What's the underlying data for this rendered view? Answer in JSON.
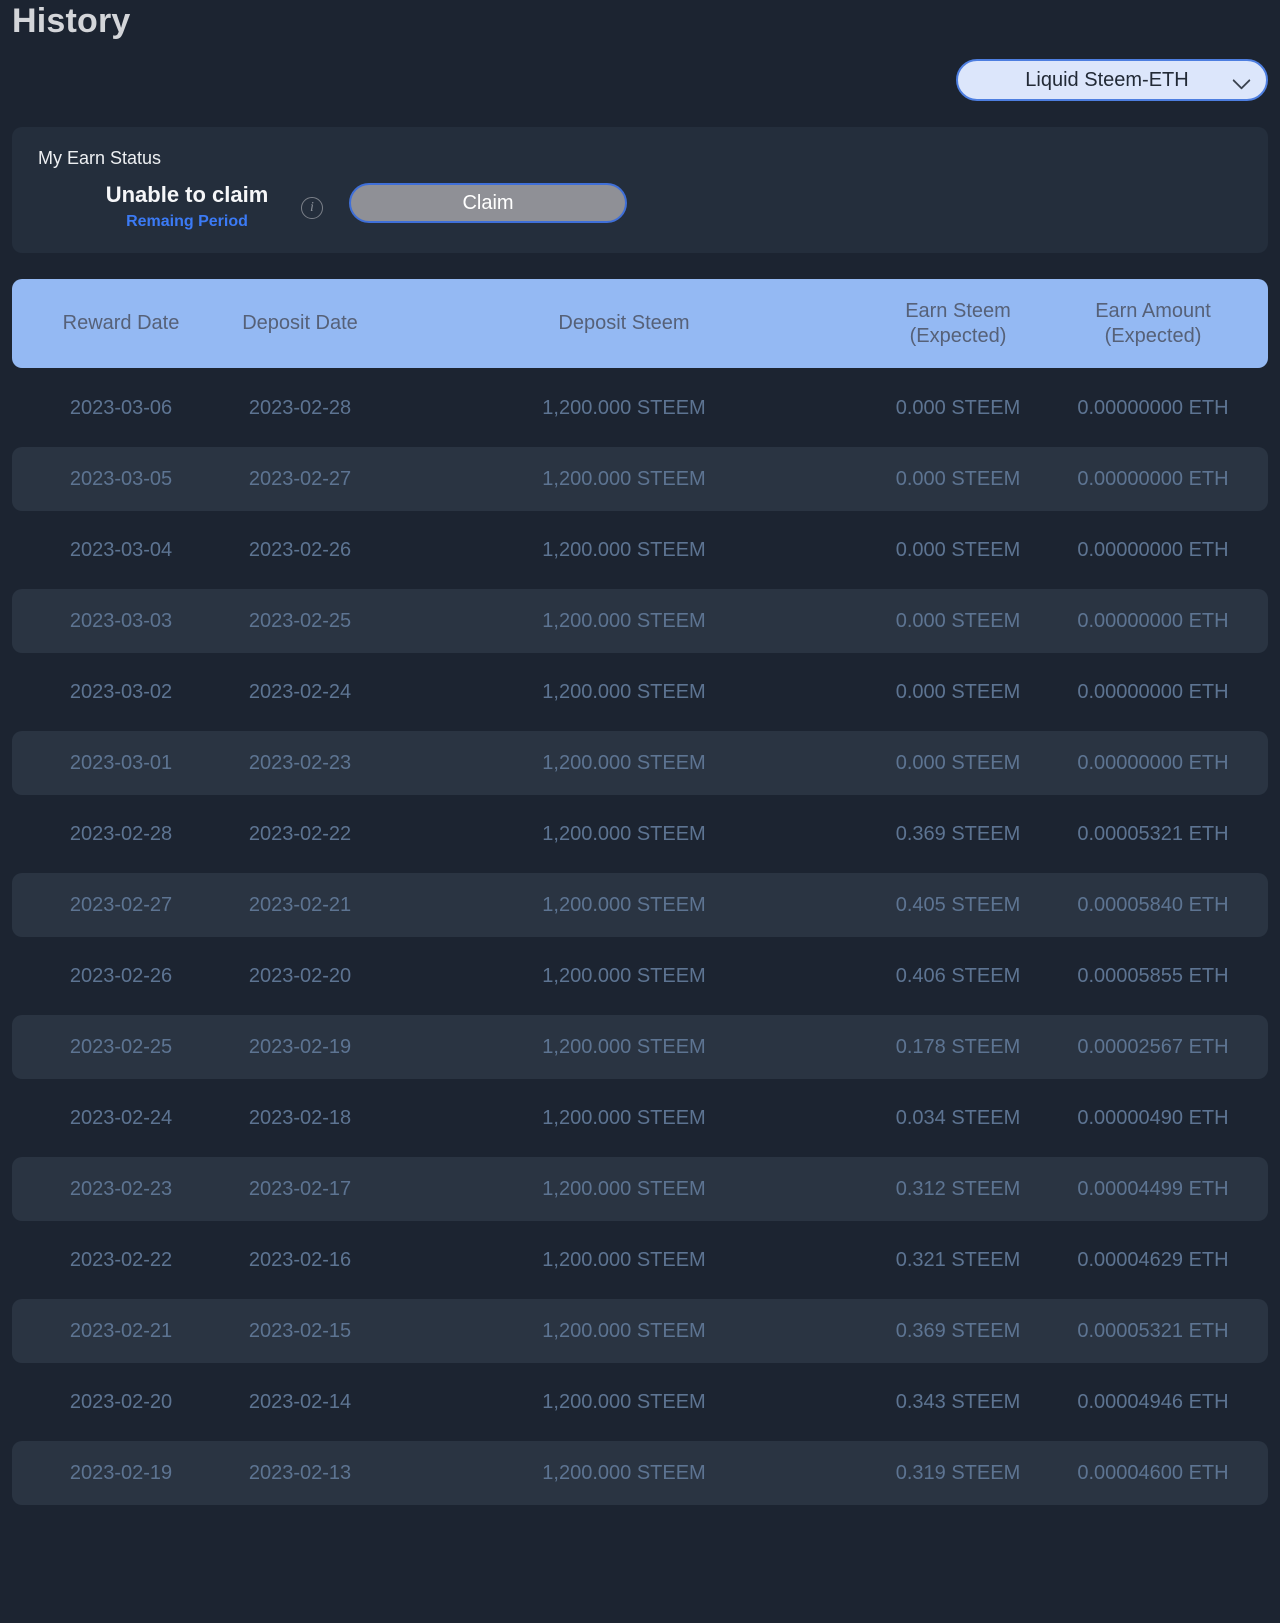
{
  "page": {
    "title": "History"
  },
  "pool_selector": {
    "value": "Liquid Steem-ETH"
  },
  "earn_status": {
    "label": "My Earn Status",
    "status": "Unable to claim",
    "remaining_link": "Remaing Period",
    "info_icon_glyph": "i",
    "claim_button": "Claim"
  },
  "colors": {
    "page_background": "#1c2431",
    "card_background": "#242e3c",
    "table_header_background": "#94b9f3",
    "alt_row_background": "#2a3442",
    "cell_text": "#5d7492",
    "header_text": "#566178",
    "link_blue": "#3b7af5",
    "claim_button_gray": "#8f9096",
    "claim_button_border": "#3f6fd8",
    "selector_background": "#dce6fb"
  },
  "table": {
    "headers": [
      "Reward Date",
      "Deposit Date",
      "Deposit Steem",
      "Earn Steem\n(Expected)",
      "Earn Amount\n(Expected)"
    ],
    "rows": [
      {
        "reward_date": "2023-03-06",
        "deposit_date": "2023-02-28",
        "deposit_steem": "1,200.000 STEEM",
        "earn_steem": "0.000 STEEM",
        "earn_amount": "0.00000000 ETH"
      },
      {
        "reward_date": "2023-03-05",
        "deposit_date": "2023-02-27",
        "deposit_steem": "1,200.000 STEEM",
        "earn_steem": "0.000 STEEM",
        "earn_amount": "0.00000000 ETH"
      },
      {
        "reward_date": "2023-03-04",
        "deposit_date": "2023-02-26",
        "deposit_steem": "1,200.000 STEEM",
        "earn_steem": "0.000 STEEM",
        "earn_amount": "0.00000000 ETH"
      },
      {
        "reward_date": "2023-03-03",
        "deposit_date": "2023-02-25",
        "deposit_steem": "1,200.000 STEEM",
        "earn_steem": "0.000 STEEM",
        "earn_amount": "0.00000000 ETH"
      },
      {
        "reward_date": "2023-03-02",
        "deposit_date": "2023-02-24",
        "deposit_steem": "1,200.000 STEEM",
        "earn_steem": "0.000 STEEM",
        "earn_amount": "0.00000000 ETH"
      },
      {
        "reward_date": "2023-03-01",
        "deposit_date": "2023-02-23",
        "deposit_steem": "1,200.000 STEEM",
        "earn_steem": "0.000 STEEM",
        "earn_amount": "0.00000000 ETH"
      },
      {
        "reward_date": "2023-02-28",
        "deposit_date": "2023-02-22",
        "deposit_steem": "1,200.000 STEEM",
        "earn_steem": "0.369 STEEM",
        "earn_amount": "0.00005321 ETH"
      },
      {
        "reward_date": "2023-02-27",
        "deposit_date": "2023-02-21",
        "deposit_steem": "1,200.000 STEEM",
        "earn_steem": "0.405 STEEM",
        "earn_amount": "0.00005840 ETH"
      },
      {
        "reward_date": "2023-02-26",
        "deposit_date": "2023-02-20",
        "deposit_steem": "1,200.000 STEEM",
        "earn_steem": "0.406 STEEM",
        "earn_amount": "0.00005855 ETH"
      },
      {
        "reward_date": "2023-02-25",
        "deposit_date": "2023-02-19",
        "deposit_steem": "1,200.000 STEEM",
        "earn_steem": "0.178 STEEM",
        "earn_amount": "0.00002567 ETH"
      },
      {
        "reward_date": "2023-02-24",
        "deposit_date": "2023-02-18",
        "deposit_steem": "1,200.000 STEEM",
        "earn_steem": "0.034 STEEM",
        "earn_amount": "0.00000490 ETH"
      },
      {
        "reward_date": "2023-02-23",
        "deposit_date": "2023-02-17",
        "deposit_steem": "1,200.000 STEEM",
        "earn_steem": "0.312 STEEM",
        "earn_amount": "0.00004499 ETH"
      },
      {
        "reward_date": "2023-02-22",
        "deposit_date": "2023-02-16",
        "deposit_steem": "1,200.000 STEEM",
        "earn_steem": "0.321 STEEM",
        "earn_amount": "0.00004629 ETH"
      },
      {
        "reward_date": "2023-02-21",
        "deposit_date": "2023-02-15",
        "deposit_steem": "1,200.000 STEEM",
        "earn_steem": "0.369 STEEM",
        "earn_amount": "0.00005321 ETH"
      },
      {
        "reward_date": "2023-02-20",
        "deposit_date": "2023-02-14",
        "deposit_steem": "1,200.000 STEEM",
        "earn_steem": "0.343 STEEM",
        "earn_amount": "0.00004946 ETH"
      },
      {
        "reward_date": "2023-02-19",
        "deposit_date": "2023-02-13",
        "deposit_steem": "1,200.000 STEEM",
        "earn_steem": "0.319 STEEM",
        "earn_amount": "0.00004600 ETH"
      }
    ]
  }
}
